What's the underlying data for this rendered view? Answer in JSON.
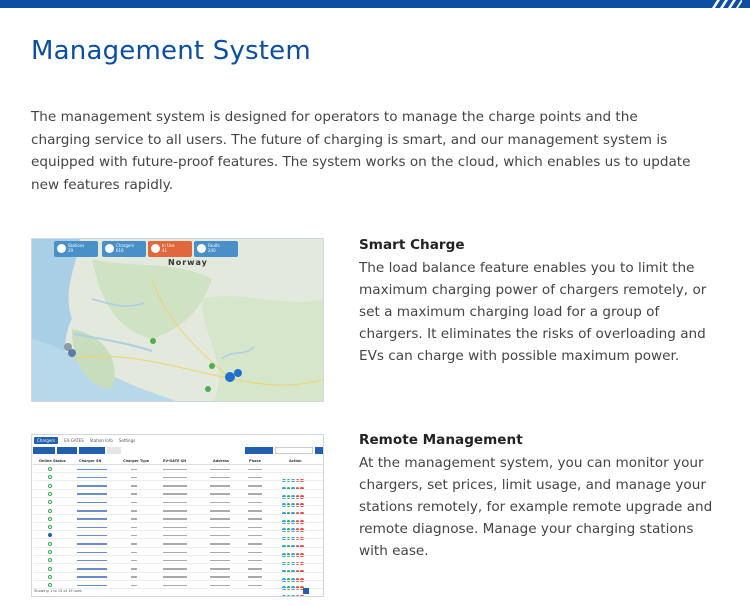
{
  "header": {
    "brand_color": "#0b4ea2"
  },
  "page": {
    "title": "Management System",
    "intro": "The management system is designed for operators to manage the charge points and the charging service to all users. The future of charging is smart, and our management system is equipped with future-proof features. The system works on the cloud, which enables us to update new features rapidly."
  },
  "features": [
    {
      "title": "Smart Charge",
      "body": "The load balance feature enables you to limit the maximum charging power of chargers remotely, or set a maximum charging load for a group of chargers. It eliminates the risks of overloading and EVs can charge with possible maximum power.",
      "image": "charger-map-screenshot"
    },
    {
      "title": "Remote Management",
      "body": "At the management system, you can monitor your chargers, set prices, limit usage, and manage your stations remotely, for example remote upgrade and remote diagnose. Manage your charging stations with ease.",
      "image": "charger-table-screenshot"
    }
  ],
  "map": {
    "country_label": "Norway",
    "stats": [
      {
        "label": "Stations",
        "value": "29"
      },
      {
        "label": "Chargers",
        "value": "616"
      },
      {
        "label": "In Use",
        "value": "41"
      },
      {
        "label": "Faults",
        "value": "240"
      }
    ]
  },
  "table": {
    "tabs": [
      "Chargers",
      "EV-GATES",
      "Station Info",
      "Settings"
    ],
    "columns": [
      "Online Status",
      "Charger SN",
      "Charger Type",
      "EV-GATE SN",
      "Address",
      "Phase",
      "Action"
    ],
    "footer": "Showing 1 to 15 of 19 rows"
  }
}
